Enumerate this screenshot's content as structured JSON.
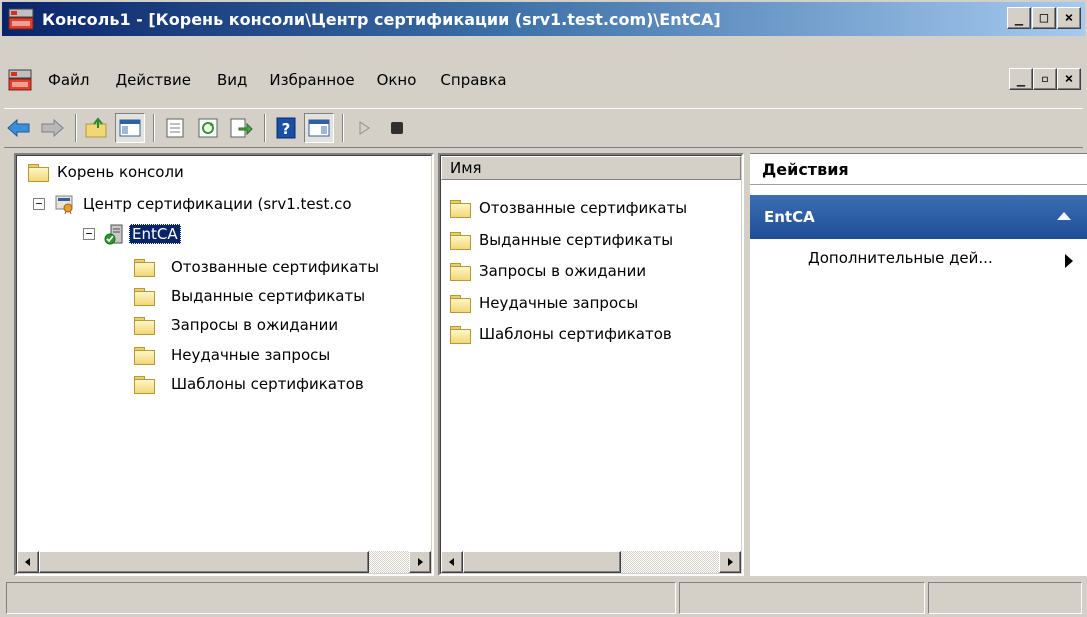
{
  "window": {
    "title": "Консоль1 - [Корень консоли\\Центр сертификации (srv1.test.com)\\EntCA]",
    "buttons": [
      "_",
      "□",
      "×"
    ]
  },
  "menu": {
    "items": [
      "Файл",
      "Действие",
      "Вид",
      "Избранное",
      "Окно",
      "Справка"
    ],
    "mdi_buttons": [
      "_",
      "▫",
      "×"
    ]
  },
  "toolbar": {
    "icons": [
      "back-icon",
      "forward-icon",
      "up-folder-icon",
      "show-hide-tree-icon",
      "properties-icon",
      "refresh-icon",
      "export-list-icon",
      "help-icon",
      "show-hide-action-pane-icon",
      "start-service-icon",
      "stop-service-icon"
    ]
  },
  "tree": {
    "root": "Корень консоли",
    "ca_node": "Центр сертификации (srv1.test.co",
    "ca_instance": "EntCA",
    "folders": [
      "Отозванные сертификаты",
      "Выданные сертификаты",
      "Запросы в ожидании",
      "Неудачные запросы",
      "Шаблоны сертификатов"
    ]
  },
  "list": {
    "column_header": "Имя",
    "items": [
      "Отозванные сертификаты",
      "Выданные сертификаты",
      "Запросы в ожидании",
      "Неудачные запросы",
      "Шаблоны сертификатов"
    ]
  },
  "actions": {
    "title": "Действия",
    "group": "EntCA",
    "item": "Дополнительные дей..."
  },
  "colors": {
    "title_bar": "#0a246a",
    "selection": "#0a246a",
    "actions_group": "#2a5ea8"
  }
}
